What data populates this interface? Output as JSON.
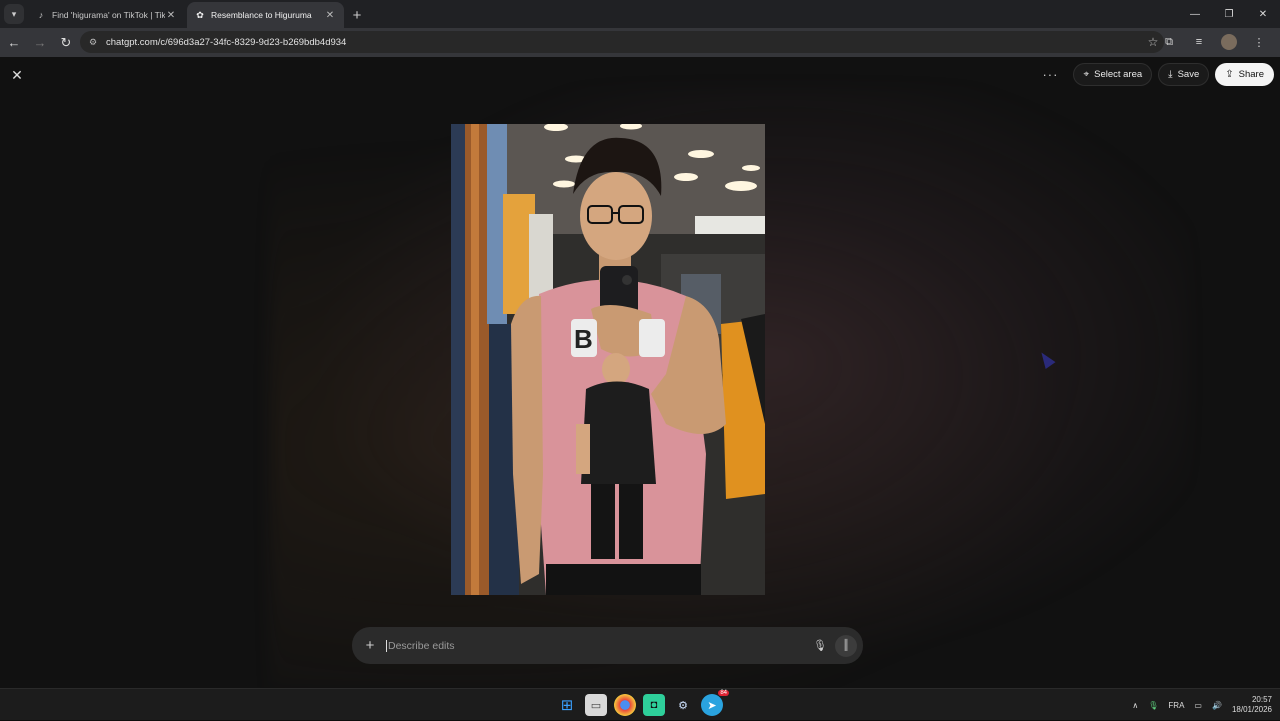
{
  "browser": {
    "tabs": [
      {
        "title": "Find 'higurama' on TikTok | TikT",
        "active": false,
        "favicon": "tiktok-icon"
      },
      {
        "title": "Resemblance to Higuruma",
        "active": true,
        "favicon": "openai-icon"
      }
    ],
    "url": "chatgpt.com/c/696d3a27-34fc-8329-9d23-b269bdb4d934"
  },
  "viewer": {
    "select_area_label": "Select area",
    "save_label": "Save",
    "share_label": "Share",
    "composer_placeholder": "Describe edits",
    "image_shirt_text": "B"
  },
  "taskbar": {
    "telegram_badge": "84",
    "language": "FRA",
    "time": "20:57",
    "date": "18/01/2026"
  },
  "colors": {
    "page_background": "#111111",
    "share_button": "#f4f4f4",
    "shirt": "#d9939a"
  }
}
